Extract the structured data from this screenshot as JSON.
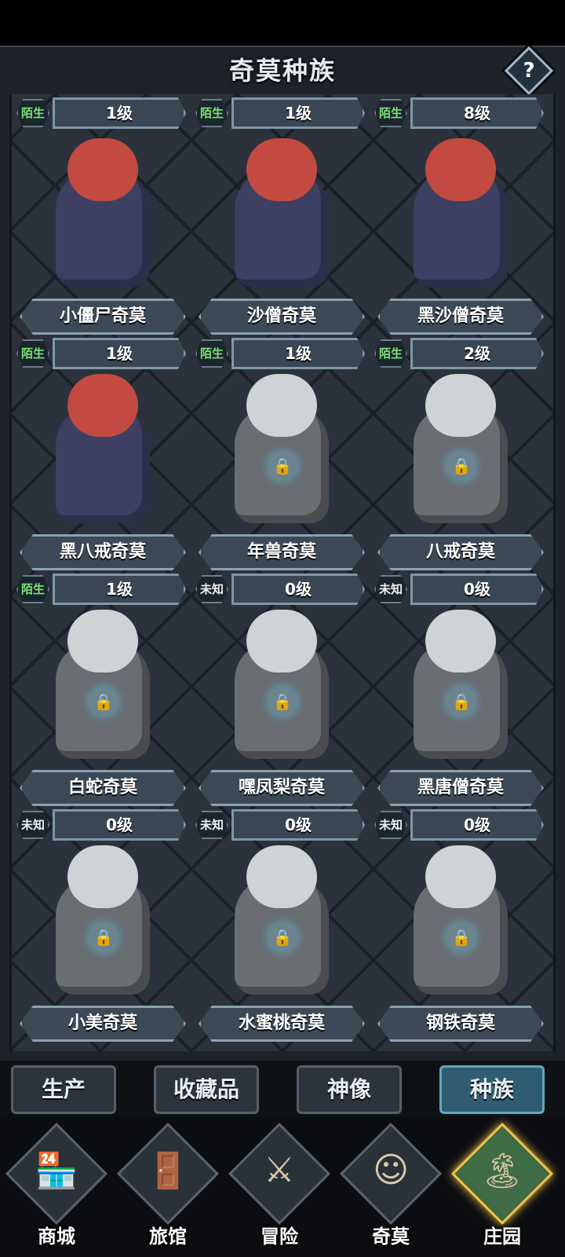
{
  "title": "奇莫种族",
  "help_label": "?",
  "top_row": [
    {
      "status": "陌生",
      "level": "1级"
    },
    {
      "status": "陌生",
      "level": "1级"
    },
    {
      "status": "陌生",
      "level": "8级"
    }
  ],
  "cards": [
    {
      "name": "小僵尸奇莫",
      "status": "陌生",
      "level": "1级",
      "locked": false
    },
    {
      "name": "沙僧奇莫",
      "status": "陌生",
      "level": "1级",
      "locked": false
    },
    {
      "name": "黑沙僧奇莫",
      "status": "陌生",
      "level": "2级",
      "locked": false
    },
    {
      "name": "黑八戒奇莫",
      "status": "陌生",
      "level": "1级",
      "locked": false
    },
    {
      "name": "年兽奇莫",
      "status": "未知",
      "level": "0级",
      "locked": true
    },
    {
      "name": "八戒奇莫",
      "status": "未知",
      "level": "0级",
      "locked": true
    },
    {
      "name": "白蛇奇莫",
      "status": "未知",
      "level": "0级",
      "locked": true
    },
    {
      "name": "嘿凤梨奇莫",
      "status": "未知",
      "level": "0级",
      "locked": true
    },
    {
      "name": "黑唐僧奇莫",
      "status": "未知",
      "level": "0级",
      "locked": true
    },
    {
      "name": "小美奇莫",
      "status": "",
      "level": "",
      "locked": true
    },
    {
      "name": "水蜜桃奇莫",
      "status": "",
      "level": "",
      "locked": true
    },
    {
      "name": "钢铁奇莫",
      "status": "",
      "level": "",
      "locked": true
    }
  ],
  "tabs": [
    {
      "label": "生产",
      "active": false
    },
    {
      "label": "收藏品",
      "active": false
    },
    {
      "label": "神像",
      "active": false
    },
    {
      "label": "种族",
      "active": true
    }
  ],
  "nav": [
    {
      "label": "商城",
      "icon": "shop-icon",
      "glyph": "🏪",
      "active": false
    },
    {
      "label": "旅馆",
      "icon": "inn-icon",
      "glyph": "🚪",
      "active": false
    },
    {
      "label": "冒险",
      "icon": "adventure-icon",
      "glyph": "⚔",
      "active": false
    },
    {
      "label": "奇莫",
      "icon": "qimo-icon",
      "glyph": "☺",
      "active": false
    },
    {
      "label": "庄园",
      "icon": "manor-icon",
      "glyph": "🏝",
      "active": true
    }
  ]
}
